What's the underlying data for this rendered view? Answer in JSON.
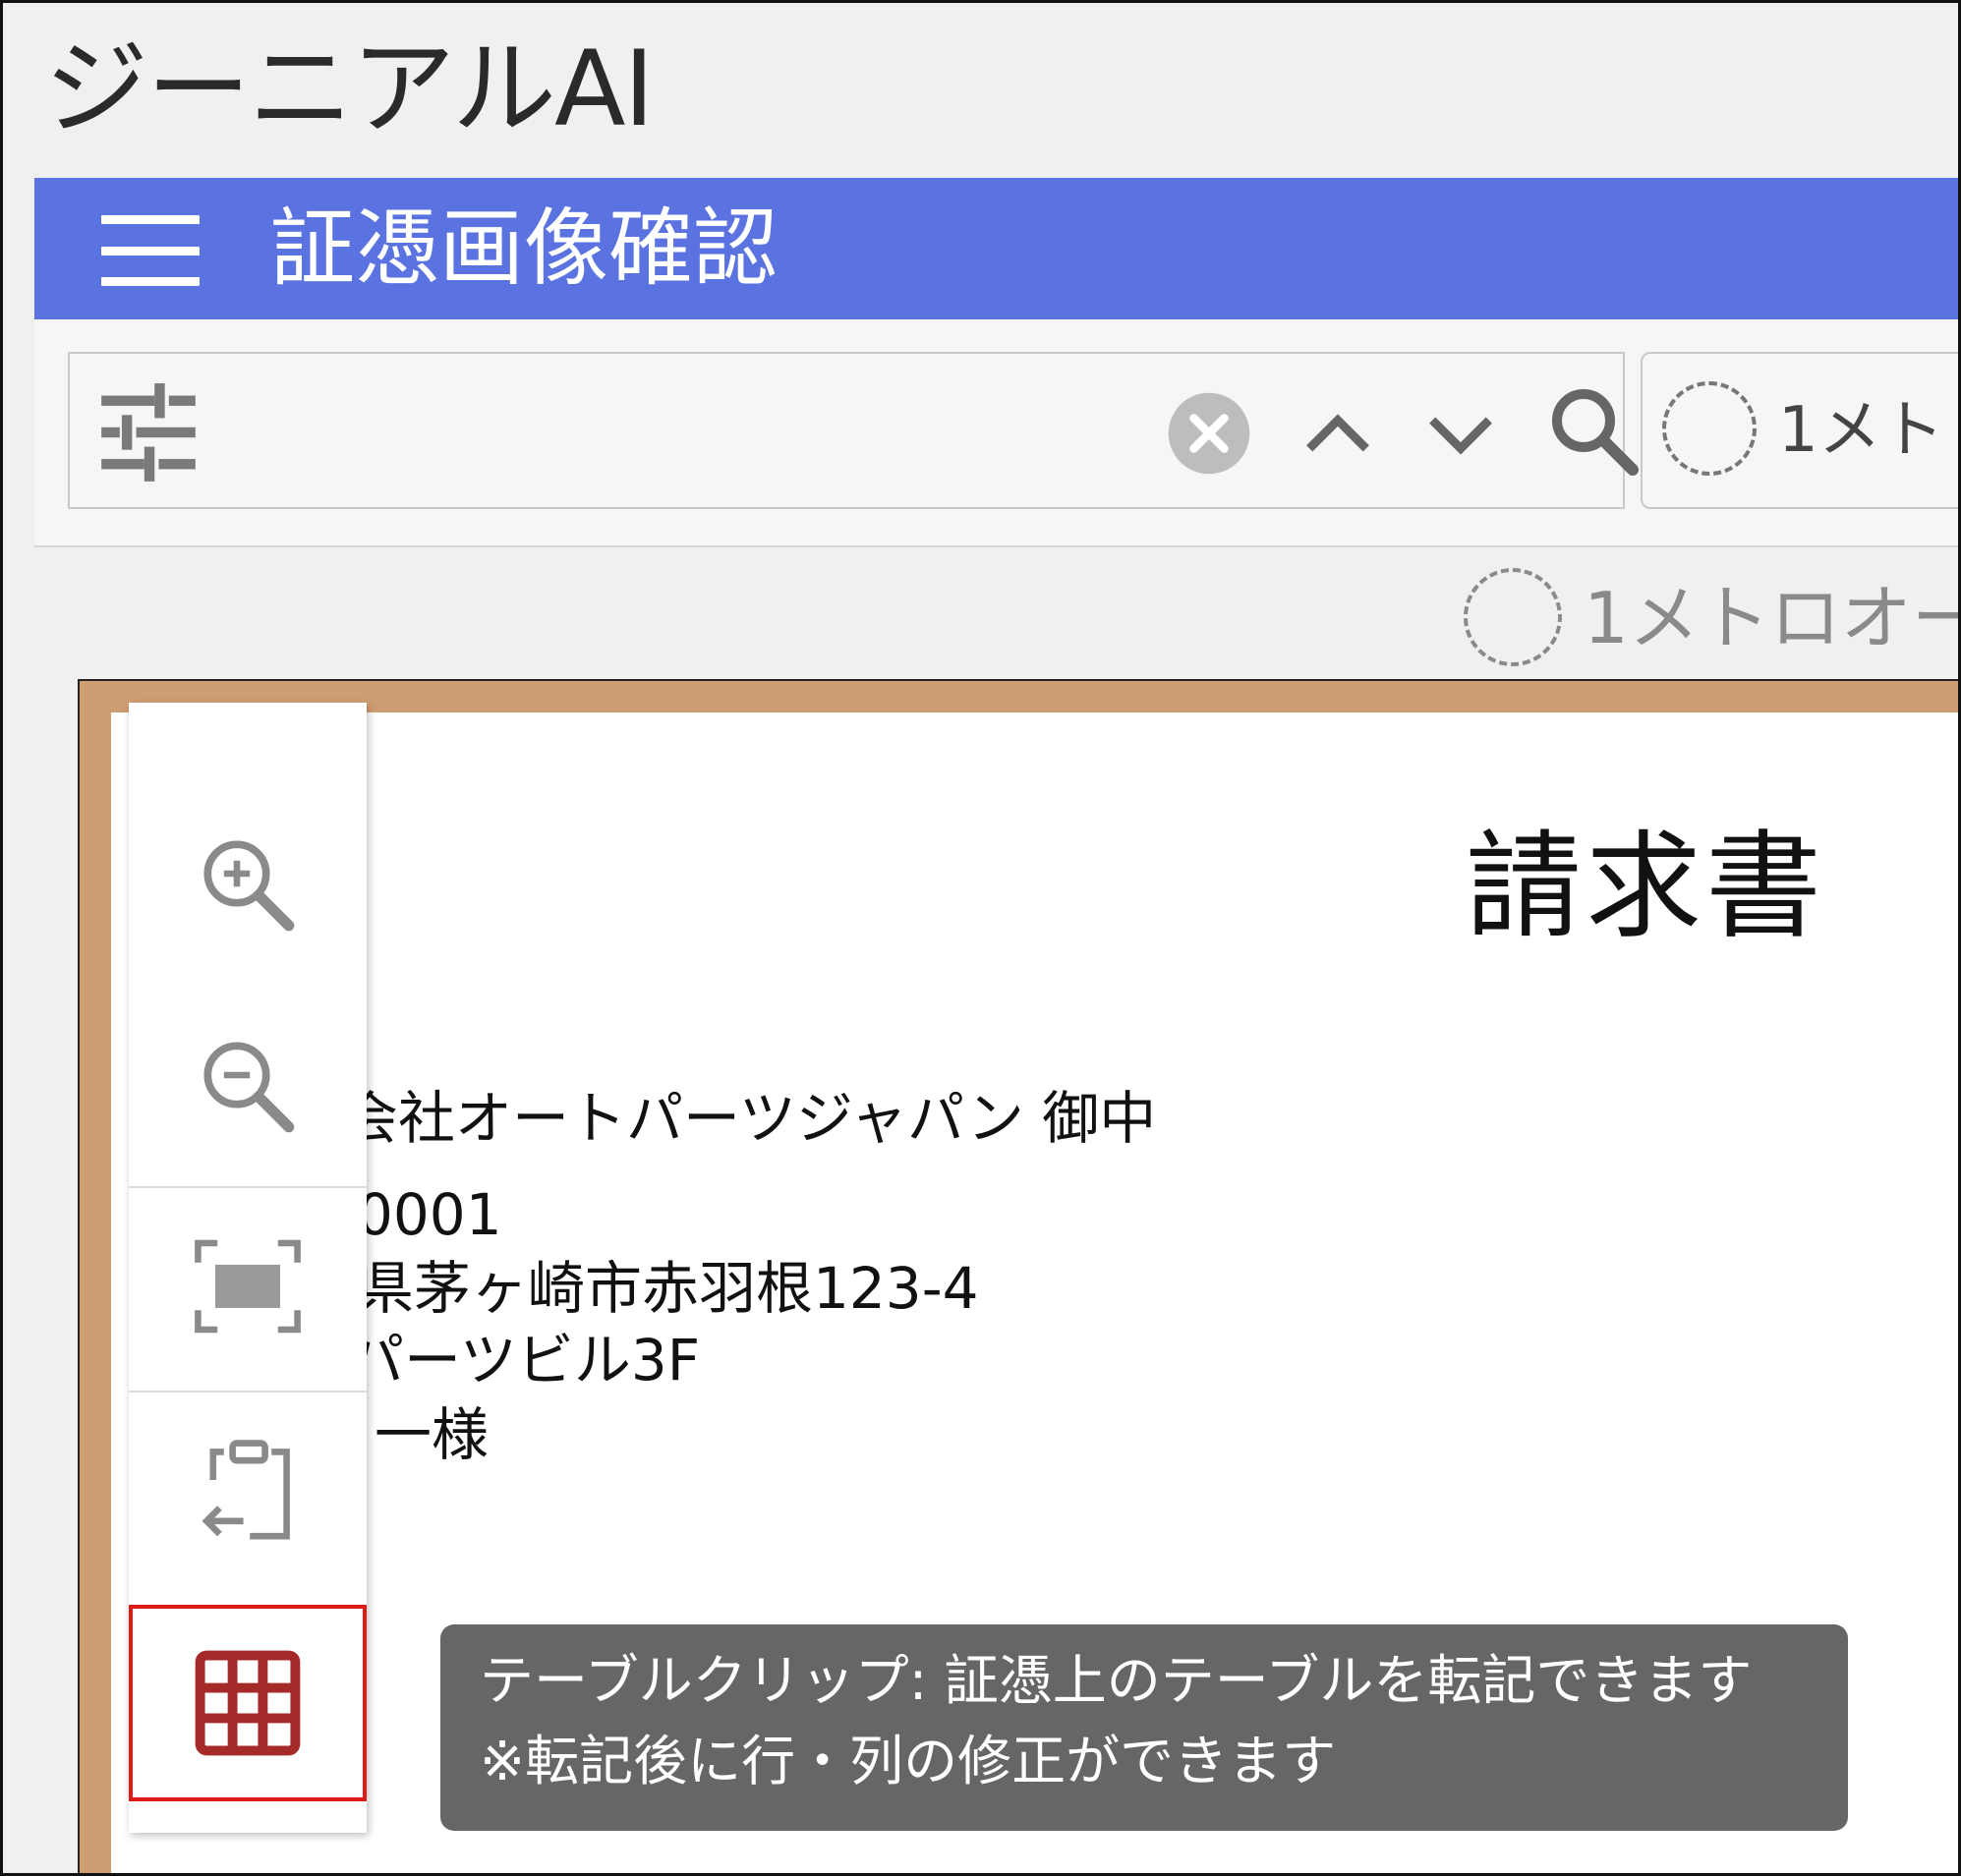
{
  "app": {
    "title": "ジーニアルAI"
  },
  "header": {
    "menu_icon": "hamburger-menu-icon",
    "title": "証憑画像確認",
    "color": "#5b73e0"
  },
  "search": {
    "value": "",
    "icons": [
      "filter-sliders-icon",
      "clear-circle-icon",
      "chevron-up-icon",
      "chevron-down-icon",
      "search-icon"
    ]
  },
  "right_field": {
    "text": "1メト"
  },
  "status": {
    "text": "1メトロオー"
  },
  "document": {
    "title": "請求書",
    "lines": [
      "会社オートパーツジャパン 御中",
      "0001",
      "県茅ヶ崎市赤羽根123-4",
      "パーツビル3F",
      "一様"
    ]
  },
  "tools": {
    "items": [
      "zoom-in-icon",
      "zoom-out-icon",
      "fit-to-screen-icon",
      "clipboard-transfer-icon",
      "table-grid-icon"
    ],
    "highlight_color": "#e01919",
    "table_icon_color": "#a52a2a"
  },
  "tooltip": {
    "line1": "テーブルクリップ: 証憑上のテーブルを転記できます",
    "line2": "※転記後に行・列の修正ができます"
  }
}
